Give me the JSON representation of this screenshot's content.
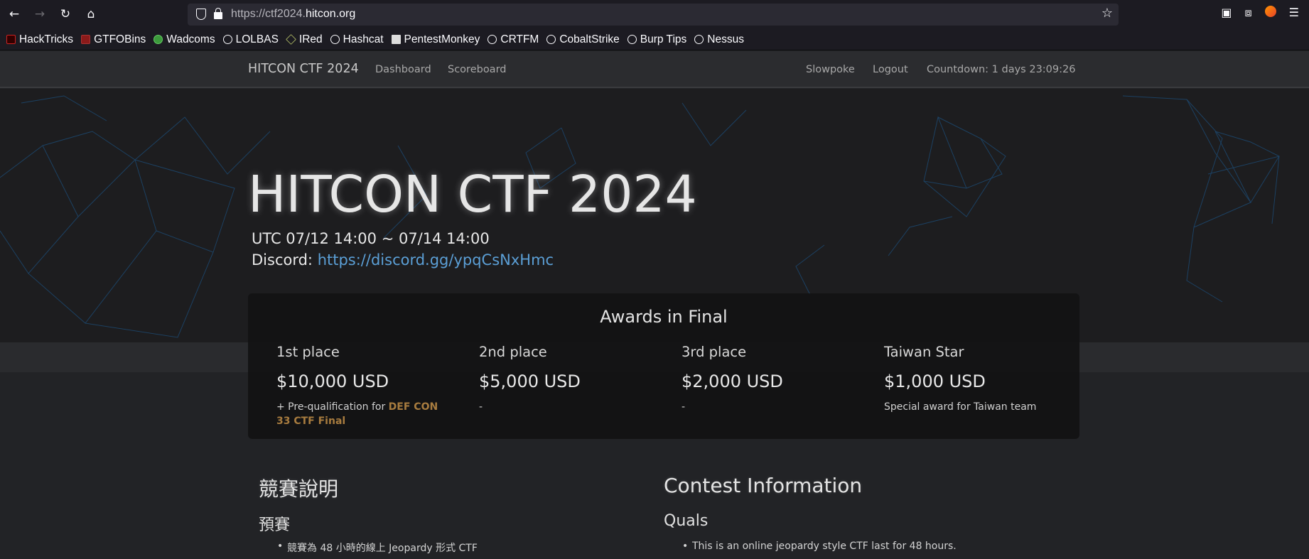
{
  "browser": {
    "url_prefix": "https://ctf2024.",
    "url_domain": "hitcon.org",
    "bookmarks": [
      {
        "label": "HackTricks",
        "icon": "hacktricks-icon"
      },
      {
        "label": "GTFOBins",
        "icon": "gtfobins-icon"
      },
      {
        "label": "Wadcoms",
        "icon": "wadcoms-icon"
      },
      {
        "label": "LOLBAS",
        "icon": "globe-icon"
      },
      {
        "label": "IRed",
        "icon": "ired-icon"
      },
      {
        "label": "Hashcat",
        "icon": "globe-icon"
      },
      {
        "label": "PentestMonkey",
        "icon": "pentestmonkey-icon"
      },
      {
        "label": "CRTFM",
        "icon": "globe-icon"
      },
      {
        "label": "CobaltStrike",
        "icon": "globe-icon"
      },
      {
        "label": "Burp Tips",
        "icon": "globe-icon"
      },
      {
        "label": "Nessus",
        "icon": "globe-icon"
      }
    ]
  },
  "nav": {
    "brand": "HITCON CTF 2024",
    "dashboard": "Dashboard",
    "scoreboard": "Scoreboard",
    "user": "Slowpoke",
    "logout": "Logout",
    "countdown": "Countdown: 1 days 23:09:26"
  },
  "hero": {
    "title": "HITCON CTF 2024",
    "date": "UTC 07/12 14:00 ~ 07/14 14:00",
    "discord_label": "Discord: ",
    "discord_link": "https://discord.gg/ypqCsNxHmc"
  },
  "awards": {
    "title": "Awards in Final",
    "items": [
      {
        "place": "1st place",
        "amount": "$10,000 USD",
        "note_prefix": "+ Pre-qualification for ",
        "note_highlight": "DEF CON 33 CTF Final"
      },
      {
        "place": "2nd place",
        "amount": "$5,000 USD",
        "note": "-"
      },
      {
        "place": "3rd place",
        "amount": "$2,000 USD",
        "note": "-"
      },
      {
        "place": "Taiwan Star",
        "amount": "$1,000 USD",
        "note": "Special award for Taiwan team"
      }
    ]
  },
  "content": {
    "zh_heading": "競賽說明",
    "zh_sub": "預賽",
    "zh_bullet_1": "競賽為 48 小時的線上 Jeopardy 形式 CTF",
    "en_heading": "Contest Information",
    "en_sub": "Quals",
    "en_bullet_1": "This is an online jeopardy style CTF last for 48 hours."
  },
  "colors": {
    "link": "#5b9fd6",
    "highlight": "#a87c3f",
    "background": "#222326"
  }
}
